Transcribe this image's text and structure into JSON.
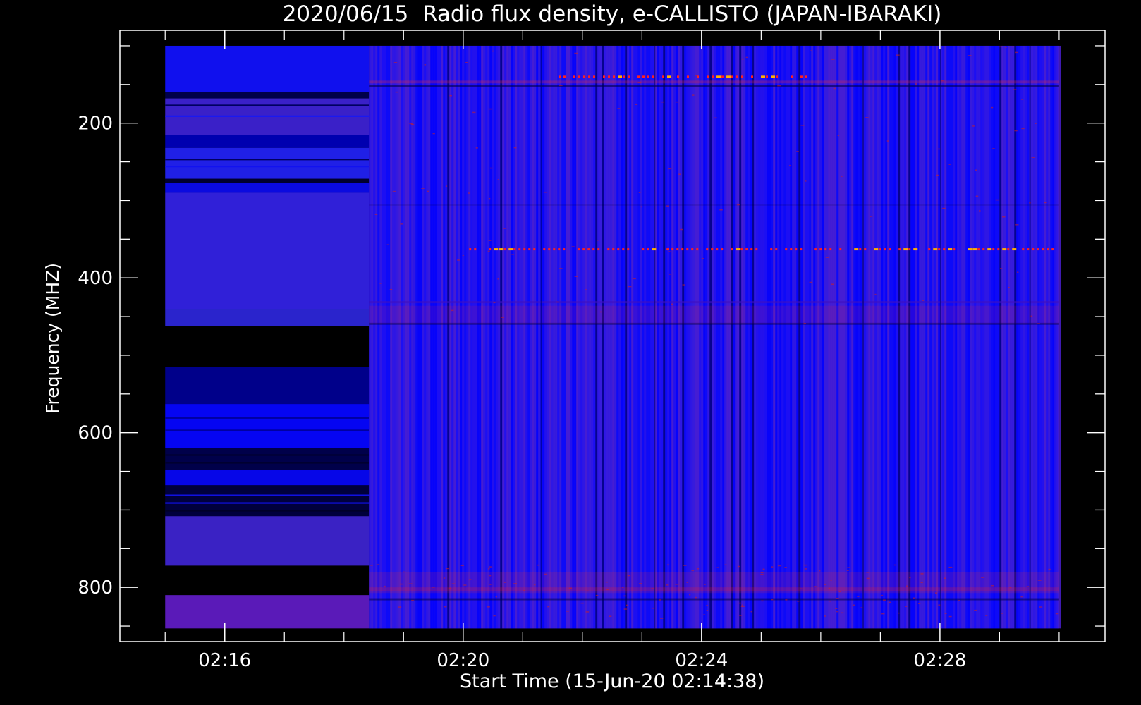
{
  "chart_data": {
    "type": "heatmap",
    "title": "2020/06/15  Radio flux density, e-CALLISTO (JAPAN-IBARAKI)",
    "xlabel": "Start Time (15-Jun-20 02:14:38)",
    "ylabel": "Frequency (MHZ)",
    "x_tick_labels": [
      "02:16",
      "02:20",
      "02:24",
      "02:28"
    ],
    "x_tick_minutes": [
      136,
      140,
      144,
      148
    ],
    "x_minor_step_minutes": 1,
    "y_tick_labels": [
      "200",
      "400",
      "600",
      "800"
    ],
    "y_tick_values": [
      200,
      400,
      600,
      800
    ],
    "y_minor_step": 50,
    "xlim_minutes": [
      134.24,
      150.77
    ],
    "ylim_mhz": [
      80,
      870
    ],
    "data_xrange_minutes": [
      135,
      150
    ],
    "data_yrange_mhz": [
      100,
      853
    ],
    "colors": {
      "background": "#000000",
      "low": "#0000ff",
      "mid": "#4020c8",
      "high": "#ff2020",
      "peak": "#ffb000"
    },
    "bursts": [
      {
        "start_min": 141.6,
        "end_min": 145.8,
        "freq_mhz": 140
      },
      {
        "start_min": 140.1,
        "end_min": 149.9,
        "freq_mhz": 363
      }
    ]
  }
}
